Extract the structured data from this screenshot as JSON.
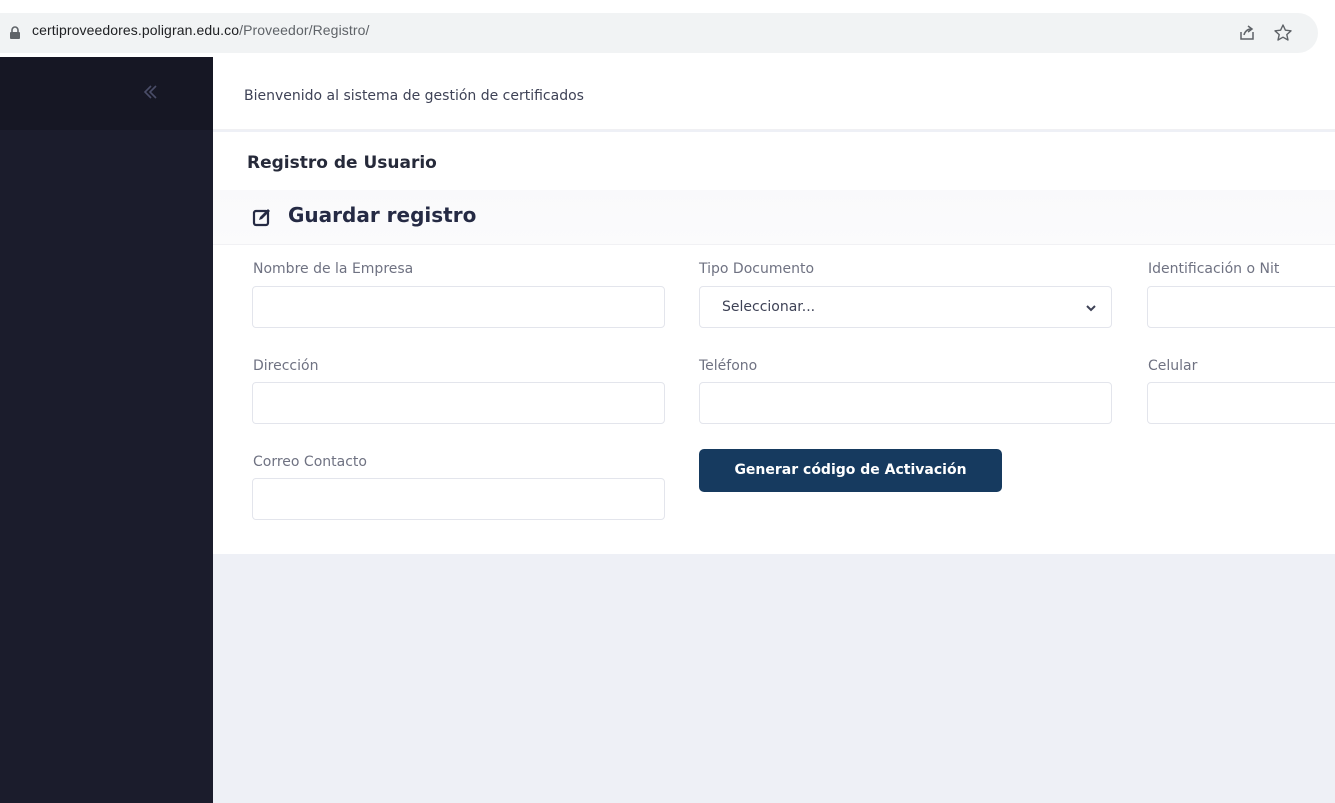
{
  "browser": {
    "url_host": "certiproveedores.poligran.edu.co",
    "url_path": "/Proveedor/Registro/",
    "icons": [
      "lock-icon",
      "share-icon",
      "star-icon"
    ]
  },
  "sidebar": {
    "collapse_icon": "chevron-double-left-icon"
  },
  "header": {
    "welcome": "Bienvenido al sistema de gestión de certificados"
  },
  "page": {
    "title": "Registro de Usuario"
  },
  "form": {
    "title": "Guardar registro",
    "title_icon": "edit-icon",
    "fields": {
      "empresa": {
        "label": "Nombre de la Empresa",
        "value": ""
      },
      "tipo_documento": {
        "label": "Tipo Documento",
        "selected": "Seleccionar..."
      },
      "identificacion": {
        "label": "Identificación o Nit",
        "value": ""
      },
      "direccion": {
        "label": "Dirección",
        "value": ""
      },
      "telefono": {
        "label": "Teléfono",
        "value": ""
      },
      "celular": {
        "label": "Celular",
        "value": ""
      },
      "correo": {
        "label": "Correo Contacto",
        "value": ""
      }
    },
    "submit_label": "Generar código de Activación"
  },
  "colors": {
    "sidebar": "#1b1c2c",
    "primary_button": "#163a5f",
    "background": "#eef0f6"
  }
}
